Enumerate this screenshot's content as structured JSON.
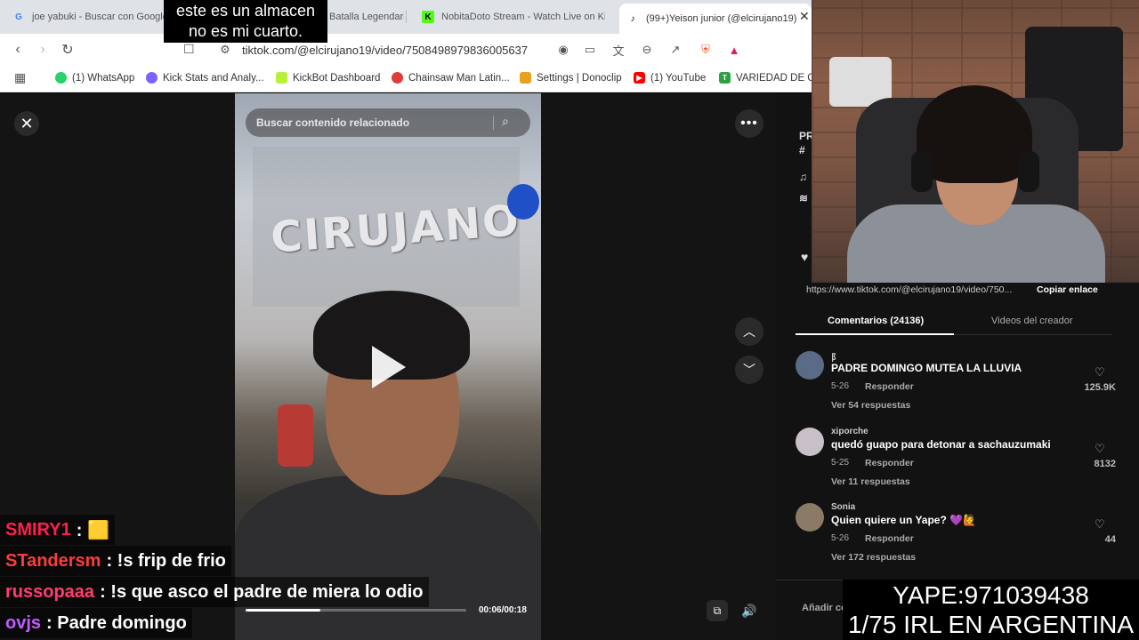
{
  "browser": {
    "tabs": [
      {
        "title": "joe yabuki - Buscar con Google",
        "favicon": "G",
        "color": "#4285f4"
      },
      {
        "title": "Batalla Legendaria",
        "favicon": "",
        "color": "#888"
      },
      {
        "title": "NobitaDoto Stream - Watch Live on Kick",
        "favicon": "K",
        "color": "#53fc18"
      },
      {
        "title": "(99+)Yeison junior (@elcirujano19)",
        "favicon": "♪",
        "color": "#000"
      }
    ],
    "url": "tiktok.com/@elcirujano19/video/7508498979836005637",
    "bookmarks": [
      {
        "label": "(1) WhatsApp",
        "color": "#25d366",
        "icon": "whatsapp-icon"
      },
      {
        "label": "Kick Stats and Analy...",
        "color": "#7b61ff",
        "icon": "kickstats-icon"
      },
      {
        "label": "KickBot Dashboard",
        "color": "#b8f03a",
        "icon": "kickbot-icon"
      },
      {
        "label": "Chainsaw Man Latin...",
        "color": "#e03c3c",
        "icon": "chainsaw-icon"
      },
      {
        "label": "Settings | Donoclip",
        "color": "#e8a21f",
        "icon": "donoclip-icon"
      },
      {
        "label": "(1) YouTube",
        "color": "#ff0000",
        "icon": "youtube-icon"
      },
      {
        "label": "VARIEDAD DE CR",
        "color": "#2ea043",
        "icon": "variedad-icon"
      }
    ]
  },
  "video": {
    "search_placeholder": "Buscar contenido relacionado",
    "time": "00:06/00:18",
    "progress": 0.34,
    "sign_text": "CIRUJANO"
  },
  "side": {
    "partial_text": [
      "PR",
      "#",
      "♫",
      "≋"
    ],
    "link_url": "https://www.tiktok.com/@elcirujano19/video/750...",
    "copy_link": "Copiar enlace",
    "tab_comments": "Comentarios (24136)",
    "tab_videos": "Videos del creador",
    "comments": [
      {
        "user": "阝",
        "text": "PADRE DOMINGO MUTEA LA LLUVIA",
        "date": "5-26",
        "reply": "Responder",
        "more": "Ver 54 respuestas",
        "likes": "125.9K"
      },
      {
        "user": "xiporche",
        "text": "quedó guapo para detonar a sachauzumaki",
        "date": "5-25",
        "reply": "Responder",
        "more": "Ver 11 respuestas",
        "likes": "8132"
      },
      {
        "user": "Sonia",
        "text": "Quien quiere un Yape? 💜🙋",
        "date": "5-26",
        "reply": "Responder",
        "more": "Ver 172 respuestas",
        "likes": "44"
      }
    ],
    "add_comment": "Añadir co"
  },
  "overlay": {
    "caption": [
      "este es un almacen",
      "no es mi cuarto."
    ],
    "chat": [
      {
        "user": "SMIRY1",
        "color": "#ff1f4f",
        "message": ": 🟨"
      },
      {
        "user": "STandersm",
        "color": "#ff3b3b",
        "message": ": !s frip de frio"
      },
      {
        "user": "russopaaa",
        "color": "#ff3d6e",
        "message": ": !s que asco el padre de miera lo odio"
      },
      {
        "user": "ovjs",
        "color": "#c15cff",
        "message": ": Padre domingo"
      }
    ],
    "yape": [
      "YAPE:971039438",
      "1/75 IRL EN ARGENTINA"
    ]
  }
}
